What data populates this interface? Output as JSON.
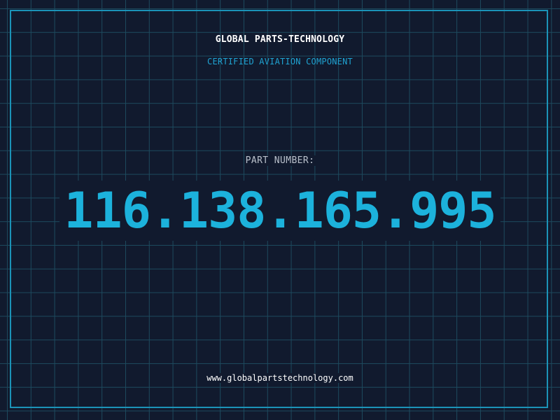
{
  "header": {
    "brand": "GLOBAL PARTS-TECHNOLOGY",
    "subtitle": "CERTIFIED AVIATION COMPONENT"
  },
  "part": {
    "label": "PART NUMBER:",
    "number": "116.138.165.995"
  },
  "footer": {
    "url": "www.globalpartstechnology.com"
  },
  "colors": {
    "background": "#111a2e",
    "grid": "#1d4a5e",
    "frame": "#1b93b8",
    "accent": "#1cb2dc",
    "label": "#b9c0cb",
    "text": "#ffffff"
  }
}
